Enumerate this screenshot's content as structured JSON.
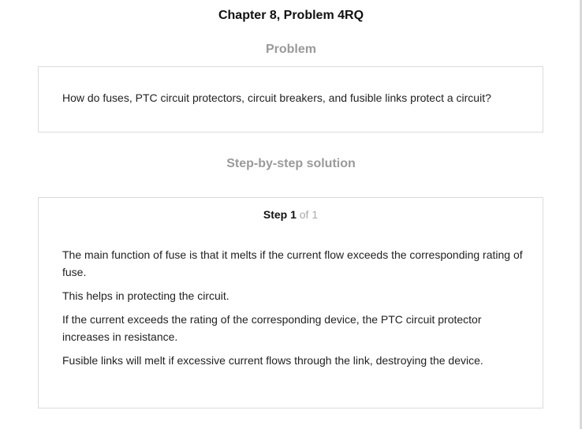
{
  "header": {
    "chapter_title": "Chapter 8, Problem 4RQ"
  },
  "problem": {
    "heading": "Problem",
    "text": "How do fuses, PTC circuit protectors, circuit breakers, and fusible links protect a circuit?"
  },
  "solution": {
    "heading": "Step-by-step solution",
    "step": {
      "label": "Step 1",
      "of_text": "of 1",
      "paragraphs": [
        "The main function of fuse is that it melts if the current flow exceeds the corresponding rating of fuse.",
        "This helps in protecting the circuit.",
        "If the current exceeds the rating of the corresponding device, the PTC circuit protector increases in resistance.",
        "Fusible links will melt if excessive current flows through the link, destroying the device."
      ]
    }
  }
}
